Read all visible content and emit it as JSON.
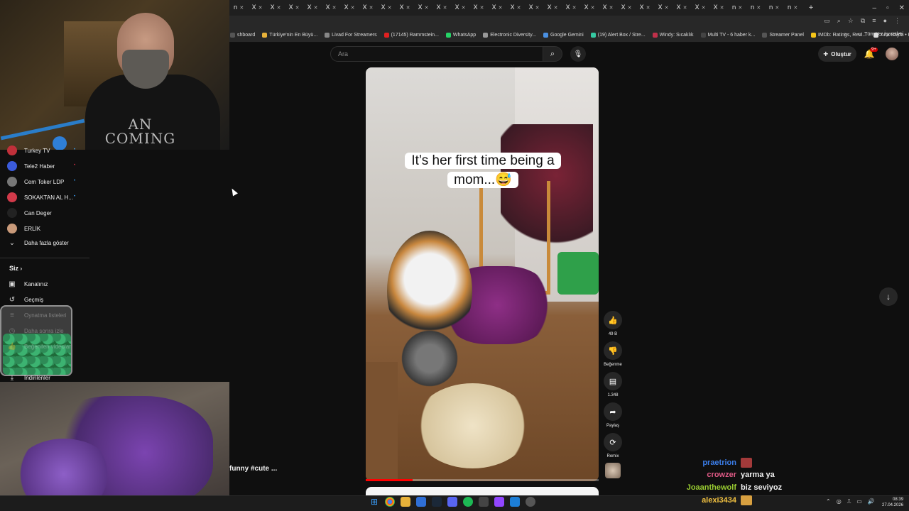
{
  "tabs": [
    "n",
    "X",
    "X",
    "X",
    "X",
    "X",
    "X",
    "X",
    "X",
    "X",
    "X",
    "X",
    "X",
    "X",
    "X",
    "X",
    "X",
    "X",
    "X",
    "X",
    "X",
    "X",
    "X",
    "X",
    "X",
    "X",
    "X",
    "n",
    "n",
    "n",
    "n"
  ],
  "bookmarks": [
    {
      "label": "shboard",
      "color": "#555555"
    },
    {
      "label": "Türkiye'nin En Büyü...",
      "color": "#e8b23a"
    },
    {
      "label": "Livad For Streamers",
      "color": "#888888"
    },
    {
      "label": "(17145) Rammstein...",
      "color": "#e02020"
    },
    {
      "label": "WhatsApp",
      "color": "#25d366"
    },
    {
      "label": "Electronic Diversity...",
      "color": "#999999"
    },
    {
      "label": "Google Gemini",
      "color": "#4a90e2"
    },
    {
      "label": "(19) Alert Box / Stre...",
      "color": "#35c9a2"
    },
    {
      "label": "Windy: Sıcaklık",
      "color": "#c0304a"
    },
    {
      "label": "Multi TV - 6 haber k...",
      "color": "#444444"
    },
    {
      "label": "Streamer Panel",
      "color": "#555555"
    },
    {
      "label": "IMDb: Ratings, Revi...",
      "color": "#f5c518"
    },
    {
      "label": "Ana Sayfa • HBO Max",
      "color": "#dddddd"
    }
  ],
  "bookmarks_more": "»",
  "bookmarks_all": "Tüm Yer İşaretleri",
  "header": {
    "search_placeholder": "Ara",
    "create_label": "Oluştur",
    "notif_badge": "9+"
  },
  "webcam_shirt_text": "AN\nCOMING",
  "sidebar": {
    "subscriptions": [
      {
        "label": "Turkey TV",
        "avatar": "#c0303a",
        "live": "•"
      },
      {
        "label": "Tele2 Haber",
        "avatar": "#3b5bdb",
        "live": "•"
      },
      {
        "label": "Cem Toker LDP",
        "avatar": "#777777",
        "live": "•"
      },
      {
        "label": "SOKAKTAN AL H...",
        "avatar": "#d23a4a",
        "live": "•"
      },
      {
        "label": "Can Deger",
        "avatar": "#222222",
        "live": ""
      },
      {
        "label": "ERLİK",
        "avatar": "#c99a7a",
        "live": ""
      }
    ],
    "show_more": "Daha fazla göster",
    "you_title": "Siz",
    "you_items": [
      {
        "label": "Kanalınız",
        "icon": "person-box-icon"
      },
      {
        "label": "Geçmiş",
        "icon": "history-icon"
      },
      {
        "label": "Oynatma listeleri",
        "icon": "playlist-icon"
      },
      {
        "label": "Daha sonra izle",
        "icon": "clock-icon"
      },
      {
        "label": "Beğenilen videolar",
        "icon": "thumb-icon"
      },
      {
        "label": "İndirilenler",
        "icon": "download-icon"
      }
    ]
  },
  "video": {
    "caption_line1": "It’s her first time being a",
    "caption_line2": "mom...😅",
    "progress": 0.2,
    "title_snippet": "funny #cute ..."
  },
  "actions": {
    "like_count": "49 B",
    "dislike_label": "Beğenme",
    "comment_count": "1.348",
    "share_label": "Paylaş",
    "remix_label": "Remix"
  },
  "chat": [
    {
      "name": "praetrion",
      "message": "",
      "color": "#3b7de8",
      "emote": "#a33a3a"
    },
    {
      "name": "crowzer",
      "message": "yarma ya",
      "color": "#e05a86",
      "emote": ""
    },
    {
      "name": "Joaanthewolf",
      "message": "biz seviyoz",
      "color": "#9acd32",
      "emote": ""
    },
    {
      "name": "alexi3434",
      "message": "",
      "color": "#f0c040",
      "emote": "#d8a040"
    }
  ],
  "clock": {
    "time": "08:39",
    "date": "27.04.2026"
  }
}
